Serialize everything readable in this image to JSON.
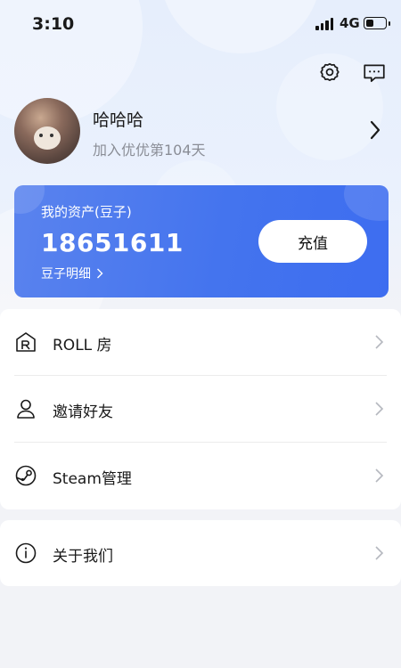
{
  "status_bar": {
    "time": "3:10",
    "network": "4G"
  },
  "profile": {
    "username": "哈哈哈",
    "join_text": "加入优优第104天"
  },
  "assets": {
    "title": "我的资产(豆子)",
    "value": "18651611",
    "detail_link": "豆子明细",
    "recharge_label": "充值"
  },
  "menu": {
    "items": [
      {
        "label": "ROLL 房",
        "icon": "roll-room-icon"
      },
      {
        "label": "邀请好友",
        "icon": "user-icon"
      },
      {
        "label": "Steam管理",
        "icon": "steam-icon"
      }
    ],
    "about": {
      "label": "关于我们",
      "icon": "info-icon"
    }
  },
  "colors": {
    "card_blue": "#4474ee",
    "background": "#f2f3f7"
  }
}
